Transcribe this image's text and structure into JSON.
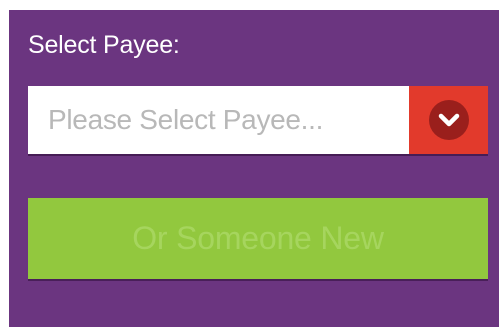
{
  "payee": {
    "label": "Select Payee:",
    "select_placeholder": "Please Select Payee...",
    "toggle_icon": "chevron-down-circle-icon",
    "new_button_label": "Or Someone New"
  },
  "colors": {
    "panel_bg": "#6b3580",
    "toggle_bg": "#e23a2c",
    "chevron_circle": "#9a1f1c",
    "button_bg": "#92c83e",
    "button_text": "#a6d55e",
    "placeholder_text": "#b8b8b8"
  }
}
